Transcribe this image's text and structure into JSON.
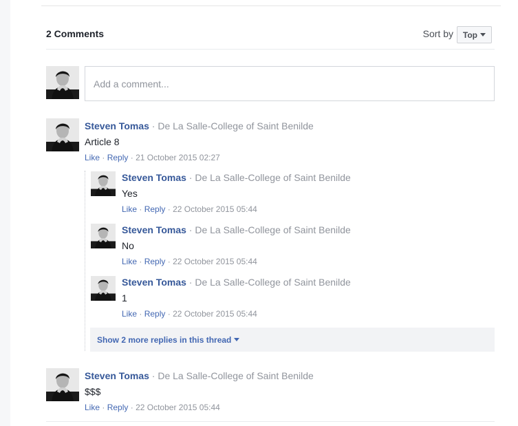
{
  "header": {
    "count_label": "2 Comments",
    "sort_label": "Sort by",
    "sort_value": "Top"
  },
  "composer": {
    "placeholder": "Add a comment..."
  },
  "comments": [
    {
      "author": "Steven Tomas",
      "affiliation": "De La Salle-College of Saint Benilde",
      "text": "Article 8",
      "like": "Like",
      "reply": "Reply",
      "time": "21 October 2015 02:27"
    },
    {
      "author": "Steven Tomas",
      "affiliation": "De La Salle-College of Saint Benilde",
      "text": "$$$",
      "like": "Like",
      "reply": "Reply",
      "time": "22 October 2015 05:44"
    }
  ],
  "replies": [
    {
      "author": "Steven Tomas",
      "affiliation": "De La Salle-College of Saint Benilde",
      "text": "Yes",
      "like": "Like",
      "reply": "Reply",
      "time": "22 October 2015 05:44"
    },
    {
      "author": "Steven Tomas",
      "affiliation": "De La Salle-College of Saint Benilde",
      "text": "No",
      "like": "Like",
      "reply": "Reply",
      "time": "22 October 2015 05:44"
    },
    {
      "author": "Steven Tomas",
      "affiliation": "De La Salle-College of Saint Benilde",
      "text": "1",
      "like": "Like",
      "reply": "Reply",
      "time": "22 October 2015 05:44"
    }
  ],
  "more_replies": {
    "label": "Show 2 more replies in this thread"
  },
  "icons": {
    "sort": "chevron-down-icon",
    "more": "chevron-down-icon"
  },
  "colors": {
    "link": "#4267b2",
    "author": "#365899",
    "muted": "#90949c"
  }
}
